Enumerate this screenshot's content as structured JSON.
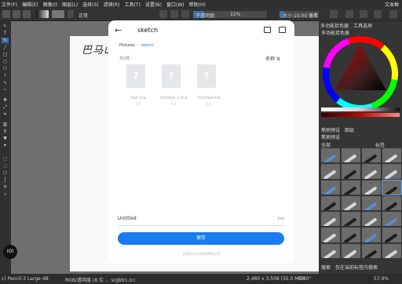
{
  "menubar": {
    "items": [
      "文件(F)",
      "编辑(E)",
      "图像(I)",
      "图层(L)",
      "选择(S)",
      "滤镜(R)",
      "工具(T)",
      "设置(N)",
      "窗口(W)",
      "帮助(H)"
    ],
    "title_right": "文本框"
  },
  "toolbar": {
    "blend_mode": "正常",
    "opacity_label": "不透明度:",
    "opacity_value": "15%",
    "opacity_fraction": 0.15,
    "size_label": "大小:",
    "size_value": "10.00 像素",
    "size_fraction": 0.12
  },
  "canvas": {
    "scribble": "巴马山"
  },
  "docker": {
    "tabs": [
      "多功能拾色器",
      "工具选项"
    ],
    "subtitle": "多功能拾色器",
    "brush_section_tabs": [
      "笔刷预设",
      "图层"
    ],
    "filter_label": "全部",
    "tag_label": "标签",
    "brush_header": "笔刷预设",
    "bottom_labels": [
      "搜索",
      "仅在当前标签内搜索"
    ],
    "brush_styles": [
      "blue",
      "light",
      "dark",
      "light",
      "light",
      "dark",
      "light",
      "light",
      "blue",
      "dark",
      "light",
      "dark",
      "dark",
      "light",
      "blue",
      "dark",
      "light",
      "dark",
      "light",
      "blue",
      "light",
      "dark",
      "blue",
      "dark",
      "light",
      "light",
      "dark",
      "light"
    ],
    "highlighted_index": 11
  },
  "status": {
    "brush": "c) Pencil-3 Large 4B",
    "color": "RGB/透明度 (8 位 ... srgbtrc.icc",
    "dims": "2,480 x 3,508 (35.0 MiB)",
    "rotation": "0.00°",
    "zoom": "57.9%"
  },
  "fab": {
    "label": "IOI"
  },
  "dialog": {
    "title": "sketch",
    "breadcrumb": [
      "Pictures",
      "sketch"
    ],
    "count": "共3项",
    "sort_label": "名称",
    "files": [
      {
        "name": "Test.kra",
        "size": "0 B"
      },
      {
        "name": "Untitled_1.kra",
        "size": "0 B"
      },
      {
        "name": "Untitled.kra",
        "size": "0 B"
      }
    ],
    "filename_value": "Untitled",
    "extension": ".kra",
    "save_label": "保存",
    "hint": "应用仅可访问你选择的文件"
  }
}
